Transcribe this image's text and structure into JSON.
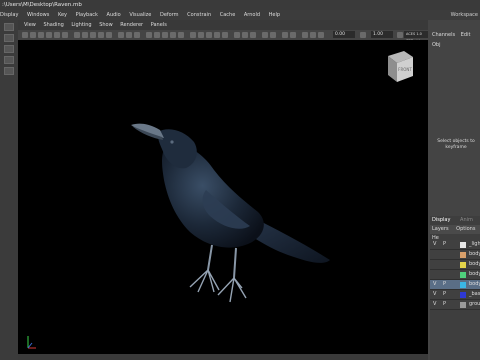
{
  "titlebar": {
    "text": ":\\Users\\M\\Desktop\\Raven.mb"
  },
  "menubar": {
    "items": [
      "Display",
      "Windows",
      "Key",
      "Playback",
      "Audio",
      "Visualize",
      "Deform",
      "Constrain",
      "Cache",
      "Arnold",
      "Help"
    ],
    "workspace": "Workspace"
  },
  "viewport_menu": {
    "items": [
      "View",
      "Shading",
      "Lighting",
      "Show",
      "Renderer",
      "Panels"
    ]
  },
  "viewport_toolbar": {
    "field1": "0.00",
    "field2": "1.00",
    "colorspace": "ACES 1.0 SDR-vid"
  },
  "viewcube": {
    "label": "FRONT"
  },
  "right_panel": {
    "tabs": [
      "Channels",
      "Edit",
      "Obj"
    ],
    "message_line1": "Select objects to",
    "message_line2": "keyframe"
  },
  "display_panel": {
    "tabs": [
      {
        "label": "Display",
        "active": true
      },
      {
        "label": "Anim",
        "active": false
      }
    ],
    "layer_menu": [
      "Layers",
      "Options",
      "He"
    ],
    "layers": [
      {
        "v": "V",
        "p": "P",
        "color": "#e8e8e8",
        "name": "_light",
        "selected": false
      },
      {
        "v": "",
        "p": "",
        "color": "#d9a06b",
        "name": "bodyF",
        "selected": false
      },
      {
        "v": "",
        "p": "",
        "color": "#e3d34a",
        "name": "bodyF",
        "selected": false
      },
      {
        "v": "",
        "p": "",
        "color": "#4fd07d",
        "name": "bodyF",
        "selected": false
      },
      {
        "v": "V",
        "p": "P",
        "color": "#3ab7e6",
        "name": "bodyF",
        "selected": true
      },
      {
        "v": "V",
        "p": "P",
        "color": "#2e39d6",
        "name": "_baseb",
        "selected": false
      },
      {
        "v": "V",
        "p": "P",
        "color": "#9a9a9a",
        "name": "groun",
        "selected": false
      }
    ]
  },
  "colors": {
    "viewport_bg": "#000000",
    "selection": "#5a6e86",
    "raven_body": "#1a2533"
  }
}
